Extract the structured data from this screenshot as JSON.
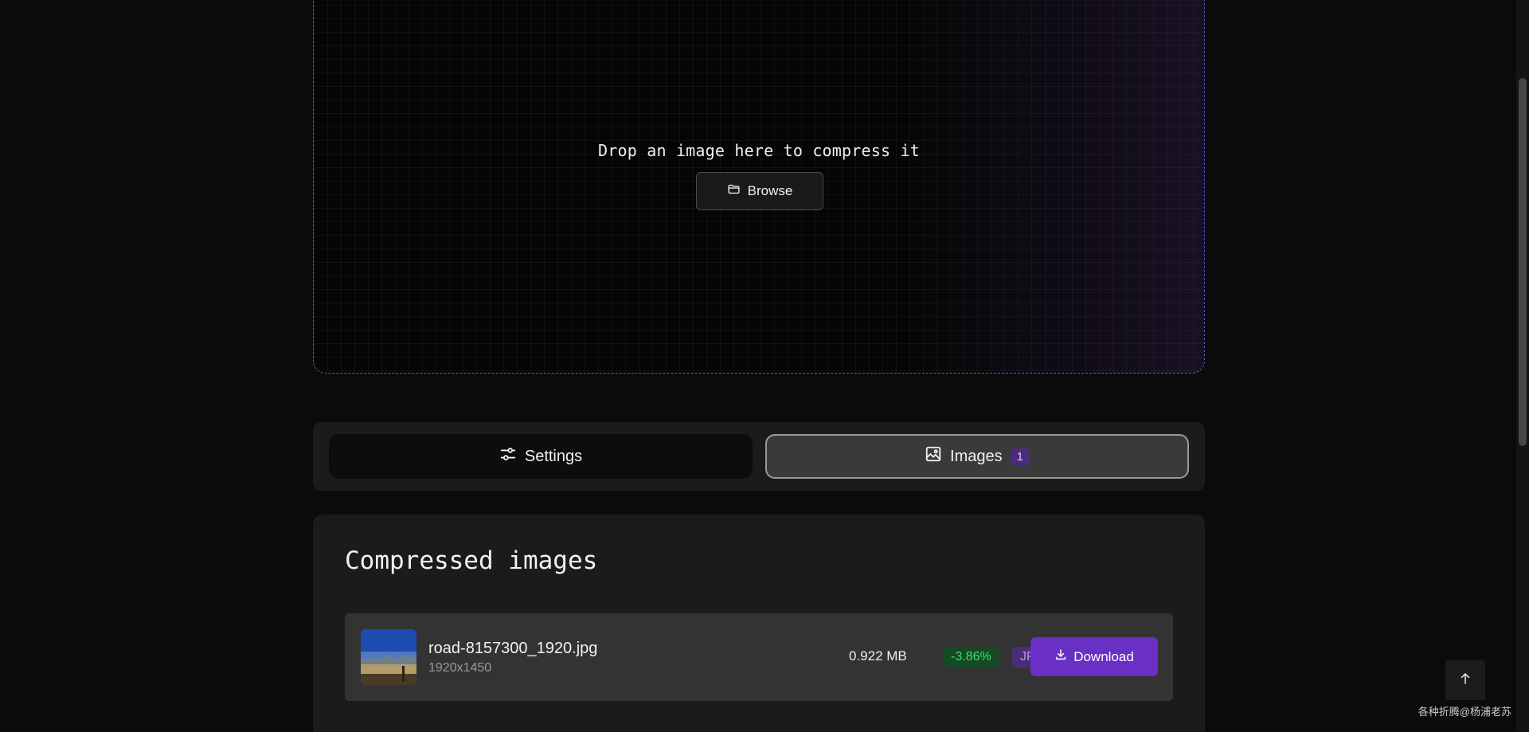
{
  "dropzone": {
    "prompt": "Drop an image here to compress it",
    "browse_label": "Browse",
    "browse_icon": "folder-icon",
    "border_color": "#6a4fd1"
  },
  "tabs": {
    "settings": {
      "label": "Settings",
      "icon": "sliders-icon"
    },
    "images": {
      "label": "Images",
      "icon": "image-icon",
      "count": "1"
    }
  },
  "compressed": {
    "title": "Compressed images",
    "items": [
      {
        "file_name": "road-8157300_1920.jpg",
        "dimensions": "1920x1450",
        "size": "0.922 MB",
        "change": "-3.86%",
        "format": "JPG",
        "download_label": "Download",
        "download_icon": "download-icon"
      }
    ]
  },
  "scroll_top_icon": "arrow-up-icon",
  "watermark": "各种折腾@杨浦老苏",
  "colors": {
    "accent": "#6a2fc4",
    "success": "#3fe06c",
    "badge_purple": "#4a2c7a"
  }
}
